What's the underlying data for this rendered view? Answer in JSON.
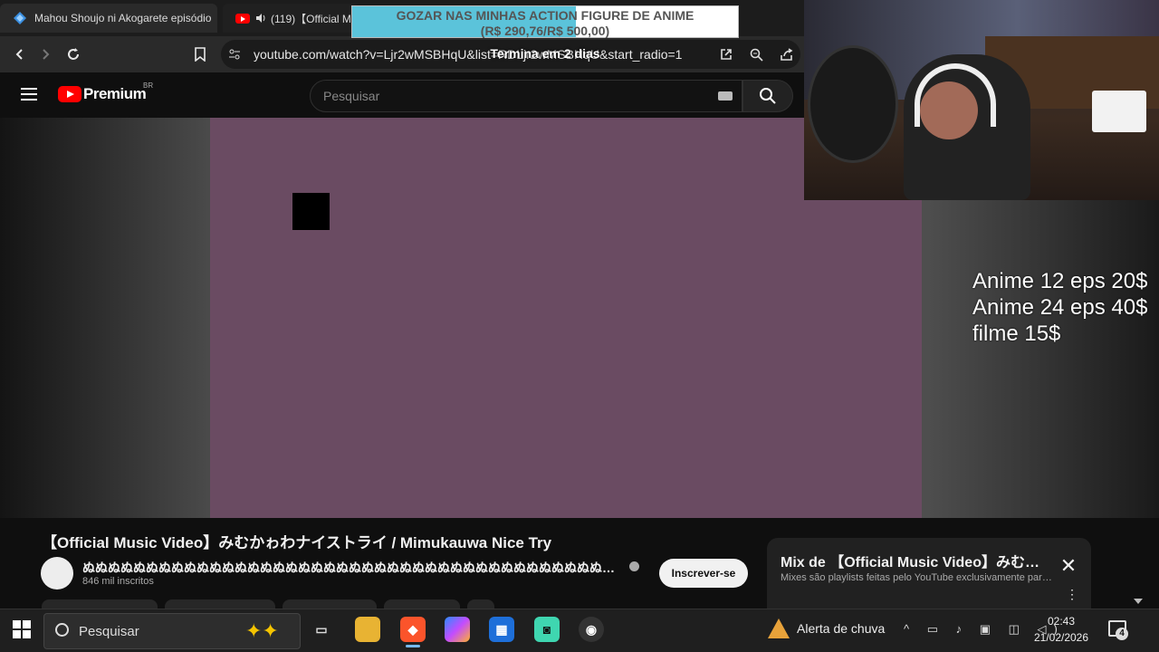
{
  "browser": {
    "tabs": [
      {
        "label": "Mahou Shoujo ni Akogarete episódio",
        "icon": "diamond-icon"
      },
      {
        "label": "(119)【Official Mu",
        "icon": "youtube-icon",
        "audio": "speaker-icon"
      }
    ],
    "url": "youtube.com/watch?v=Ljr2wMSBHqU&list=RDLjr2wMSBHqU&start_radio=1"
  },
  "overlay": {
    "goal_line1": "GOZAR NAS MINHAS ACTION FIGURE DE ANIME",
    "goal_line2": "(R$ 290,76/R$ 500,00)",
    "goal_progress": 0.58,
    "goal_footer": "Termina em 2 dias"
  },
  "youtube": {
    "logo_text": "Premium",
    "region": "BR",
    "search_placeholder": "Pesquisar",
    "video_color": "#6a4b62",
    "video_title": "【Official Music Video】みむかゎわナイストライ / Mimukauwa Nice Try",
    "channel_name": "ぬぬぬぬぬぬぬぬぬぬぬぬぬぬぬぬぬぬぬぬぬぬぬぬぬぬぬぬぬぬぬぬぬぬぬぬぬぬぬぬぬぬぬぬぬぬぬぬぬぬ…",
    "subscribers": "846 mil inscritos",
    "subscribe_label": "Inscrever-se",
    "mix": {
      "title": "Mix de 【Official Music Video】みむ…",
      "subtitle": "Mixes são playlists feitas pelo YouTube exclusivamente para…",
      "close": "✕",
      "more": "⋮"
    }
  },
  "stream_overlay": {
    "price_lines": [
      "Anime 12 eps 20$",
      "Anime 24 eps 40$",
      "filme 15$"
    ]
  },
  "taskbar": {
    "search_placeholder": "Pesquisar",
    "weather": "Alerta de chuva",
    "time": "02:43",
    "date": "21/02/2026",
    "notifications": "4"
  }
}
